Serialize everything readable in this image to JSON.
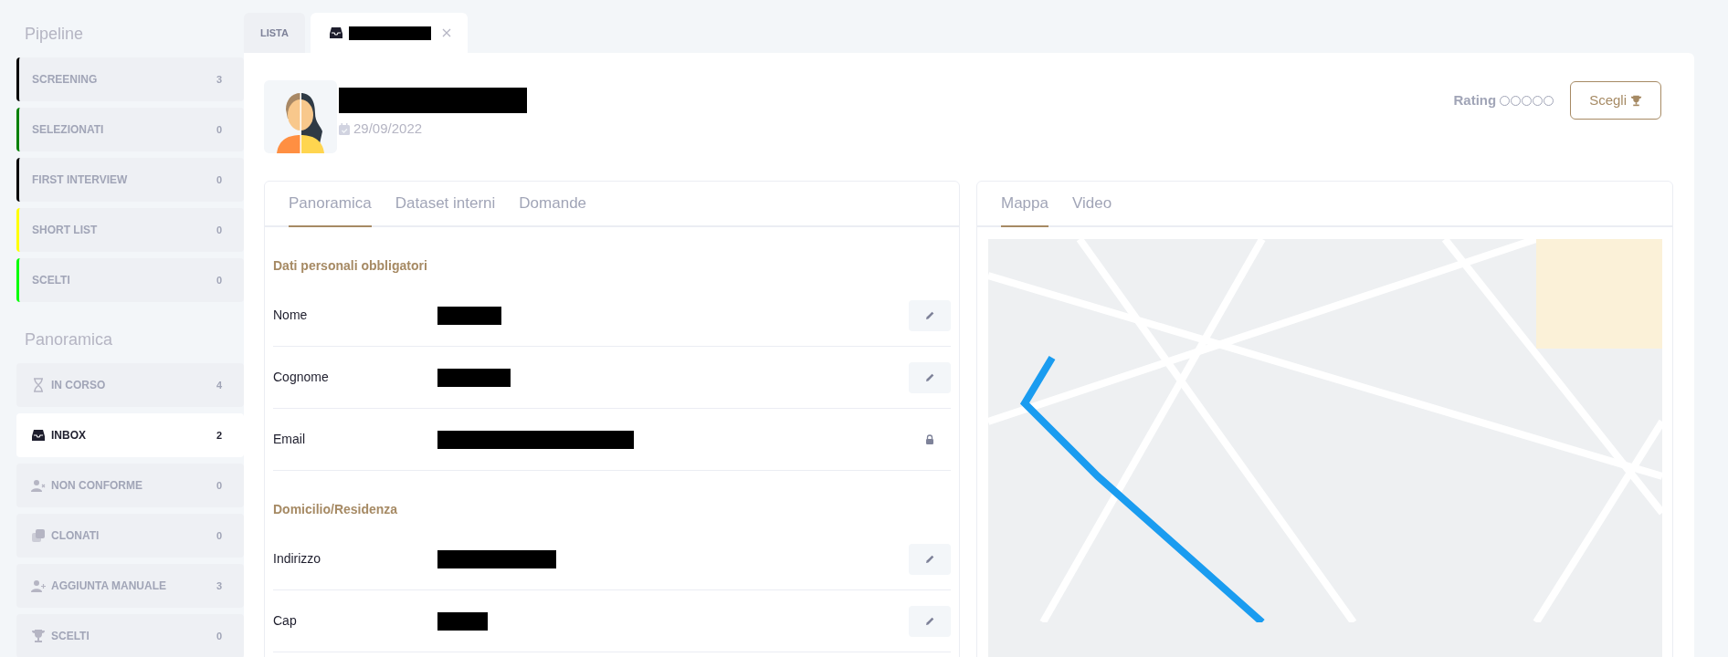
{
  "pipeline": {
    "title": "Pipeline",
    "items": [
      {
        "label": "SCREENING",
        "count": "3",
        "color": "#000000"
      },
      {
        "label": "SELEZIONATI",
        "count": "0",
        "color": "#008000"
      },
      {
        "label": "FIRST INTERVIEW",
        "count": "0",
        "color": "#000000"
      },
      {
        "label": "SHORT LIST",
        "count": "0",
        "color": "#ffff00"
      },
      {
        "label": "SCELTI",
        "count": "0",
        "color": "#00ff00"
      }
    ]
  },
  "overview": {
    "title": "Panoramica",
    "items": [
      {
        "kind": "hourglass",
        "label": "IN CORSO",
        "count": "4",
        "selected": false
      },
      {
        "kind": "inbox",
        "label": "INBOX",
        "count": "2",
        "selected": true
      },
      {
        "kind": "user-x",
        "label": "NON CONFORME",
        "count": "0",
        "selected": false
      },
      {
        "kind": "clone",
        "label": "CLONATI",
        "count": "0",
        "selected": false
      },
      {
        "kind": "user-plus",
        "label": "AGGIUNTA MANUALE",
        "count": "3",
        "selected": false
      },
      {
        "kind": "trophy",
        "label": "SCELTI",
        "count": "0",
        "selected": false
      }
    ]
  },
  "tabs": [
    {
      "kind": "list",
      "label": "LISTA",
      "selected": false
    },
    {
      "kind": "candidate",
      "selected": true
    }
  ],
  "profile": {
    "date": "29/09/2022",
    "rating": {
      "label": "Rating",
      "stars": 0
    },
    "choose_button": "Scegli"
  },
  "left_panel": {
    "tabs": [
      {
        "label": "Panoramica",
        "selected": true
      },
      {
        "label": "Dataset interni",
        "selected": false
      },
      {
        "label": "Domande",
        "selected": false
      }
    ],
    "sections": [
      {
        "title": "Dati personali obbligatori",
        "fields": [
          {
            "label": "Nome",
            "locked": false
          },
          {
            "label": "Cognome",
            "locked": false
          },
          {
            "label": "Email",
            "locked": true
          }
        ]
      },
      {
        "title": "Domicilio/Residenza",
        "fields": [
          {
            "label": "Indirizzo",
            "locked": false
          },
          {
            "label": "Cap",
            "locked": false
          }
        ]
      }
    ]
  },
  "right_panel": {
    "tabs": [
      {
        "label": "Mappa",
        "selected": true
      },
      {
        "label": "Video",
        "selected": false
      }
    ]
  }
}
